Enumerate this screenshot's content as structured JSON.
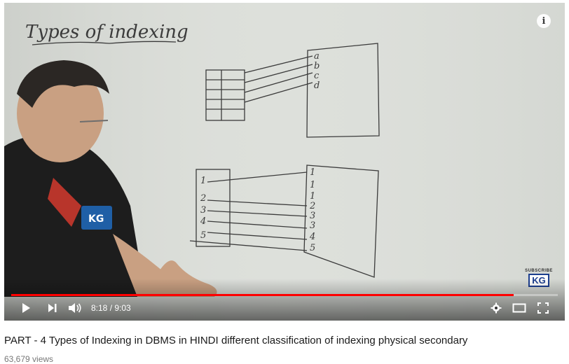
{
  "player": {
    "current_time": "8:18",
    "duration": "9:03",
    "time_display": "8:18 / 9:03",
    "progress_fraction": 0.919,
    "info_icon": "info-icon",
    "subscribe_label": "SUBSCRIBE",
    "subscribe_logo": "KG",
    "colors": {
      "progress": "#ff0000",
      "controls": "#ffffff"
    }
  },
  "whiteboard": {
    "heading": "Types of indexing",
    "top_letters": [
      "a",
      "b",
      "c",
      "d"
    ],
    "bottom_left": [
      "1",
      "2",
      "3",
      "4",
      "5"
    ],
    "bottom_right": [
      "1",
      "1",
      "1",
      "2",
      "3",
      "3",
      "4",
      "5"
    ],
    "shirt_logo": "KG"
  },
  "video": {
    "title": "PART - 4 Types of Indexing in DBMS in HINDI different classification of indexing physical secondary",
    "views": "63,679 views"
  }
}
